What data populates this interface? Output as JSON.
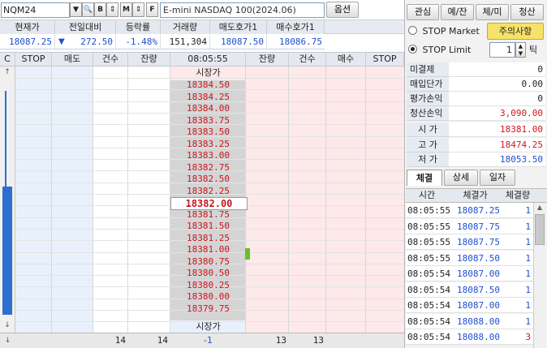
{
  "symbol": {
    "code": "NQM24",
    "name": "E-mini NASDAQ 100(2024.06)",
    "option_label": "옵션"
  },
  "toolbar_icons": [
    "search-icon",
    "buy-icon",
    "updown-icon",
    "sell-icon",
    "updown-icon",
    "f-icon"
  ],
  "quote_header": [
    "현재가",
    "전일대비",
    "등락률",
    "거래량",
    "매도호가1",
    "매수호가1"
  ],
  "quote_values": {
    "current": "18087.25",
    "change_arrow": "▼",
    "change": "272.50",
    "rate": "-1.48%",
    "volume": "151,304",
    "ask1": "18087.50",
    "bid1": "18086.75"
  },
  "ladder_headers": {
    "c": "C",
    "stop_l": "STOP",
    "sell": "매도",
    "count_l": "건수",
    "remain_l": "잔량",
    "time": "08:05:55",
    "remain_r": "잔량",
    "count_r": "건수",
    "buy": "매수",
    "stop_r": "STOP"
  },
  "market_label": "시장가",
  "prices": [
    "18384.50",
    "18384.25",
    "18384.00",
    "18383.75",
    "18383.50",
    "18383.25",
    "18383.00",
    "18382.75",
    "18382.50",
    "18382.25",
    "18382.00",
    "18381.75",
    "18381.50",
    "18381.25",
    "18381.00",
    "18380.75",
    "18380.50",
    "18380.25",
    "18380.00",
    "18379.75"
  ],
  "current_price_index": 10,
  "footer": {
    "sell_count": "14",
    "sell_remain": "14",
    "diff": "-1",
    "buy_remain": "13",
    "buy_count": "13"
  },
  "right_buttons": [
    "관심",
    "예/잔",
    "체/미",
    "청산"
  ],
  "stop_market_label": "STOP Market",
  "stop_limit_label": "STOP Limit",
  "notice_label": "주의사항",
  "tick_value": "1",
  "tick_unit": "틱",
  "position": [
    {
      "label": "미결제",
      "value": "0"
    },
    {
      "label": "매입단가",
      "value": "0.00"
    },
    {
      "label": "평가손익",
      "value": "0"
    },
    {
      "label": "청산손익",
      "value": "3,090.00"
    }
  ],
  "ohl": [
    {
      "label": "시 가",
      "value": "18381.00"
    },
    {
      "label": "고 가",
      "value": "18474.25"
    },
    {
      "label": "저 가",
      "value": "18053.50"
    }
  ],
  "tabs": [
    "체결",
    "상세",
    "일자"
  ],
  "ticks_header": [
    "시간",
    "체결가",
    "체결량"
  ],
  "ticks": [
    {
      "time": "08:05:55",
      "price": "18087.25",
      "qty": "1"
    },
    {
      "time": "08:05:55",
      "price": "18087.75",
      "qty": "1"
    },
    {
      "time": "08:05:55",
      "price": "18087.75",
      "qty": "1"
    },
    {
      "time": "08:05:55",
      "price": "18087.50",
      "qty": "1"
    },
    {
      "time": "08:05:54",
      "price": "18087.00",
      "qty": "1"
    },
    {
      "time": "08:05:54",
      "price": "18087.50",
      "qty": "1"
    },
    {
      "time": "08:05:54",
      "price": "18087.00",
      "qty": "1"
    },
    {
      "time": "08:05:54",
      "price": "18088.00",
      "qty": "1"
    },
    {
      "time": "08:05:54",
      "price": "18088.00",
      "qty": "3"
    }
  ],
  "colors": {
    "ask_bg": "#e8f1fb",
    "bid_bg": "#fde8ea",
    "center_bg": "#d4d4d4",
    "up": "#d0161c",
    "down": "#1f4fd1"
  }
}
